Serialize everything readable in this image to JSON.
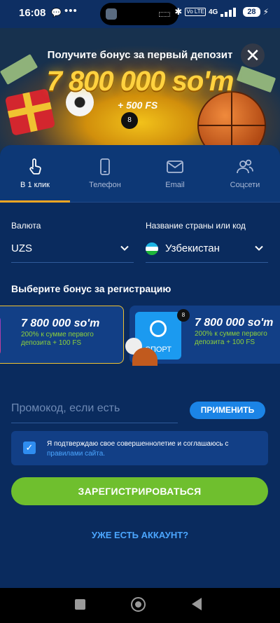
{
  "status_bar": {
    "time": "16:08",
    "volte": "Vo LTE",
    "network": "4G",
    "battery": "28"
  },
  "banner": {
    "title": "Получите бонус за первый депозит",
    "amount": "7 800 000 so'm",
    "fs": "+ 500 FS"
  },
  "tabs": [
    {
      "label": "В 1 клик",
      "icon": "tap-icon",
      "active": true
    },
    {
      "label": "Телефон",
      "icon": "phone-icon",
      "active": false
    },
    {
      "label": "Email",
      "icon": "mail-icon",
      "active": false
    },
    {
      "label": "Соцсети",
      "icon": "users-icon",
      "active": false
    }
  ],
  "form": {
    "currency_label": "Валюта",
    "currency_value": "UZS",
    "country_label": "Название страны или код",
    "country_value": "Узбекистан"
  },
  "bonus": {
    "title": "Выберите бонус за регистрацию",
    "cards": [
      {
        "amount": "7 800 000 so'm",
        "desc": "200% к сумме первого депозита + 100 FS",
        "selected": true
      },
      {
        "amount": "7 800 000 so'm",
        "desc": "200% к сумме первого депозита + 100 FS",
        "tile": "СПОРТ",
        "selected": false
      }
    ]
  },
  "promo": {
    "placeholder": "Промокод, если есть",
    "apply_label": "ПРИМЕНИТЬ"
  },
  "agreement": {
    "text": "Я подтверждаю свое совершеннолетие и соглашаюсь с",
    "link": "правилами сайта.",
    "checked": true
  },
  "actions": {
    "register_label": "ЗАРЕГИСТРИРОВАТЬСЯ",
    "login_label": "УЖЕ ЕСТЬ АККАУНТ?"
  },
  "colors": {
    "background": "#0a2b5e",
    "accent_tab": "#f5a623",
    "register": "#6fbf2e",
    "link": "#4ba6ff",
    "bonus_text": "#8ed13b"
  }
}
